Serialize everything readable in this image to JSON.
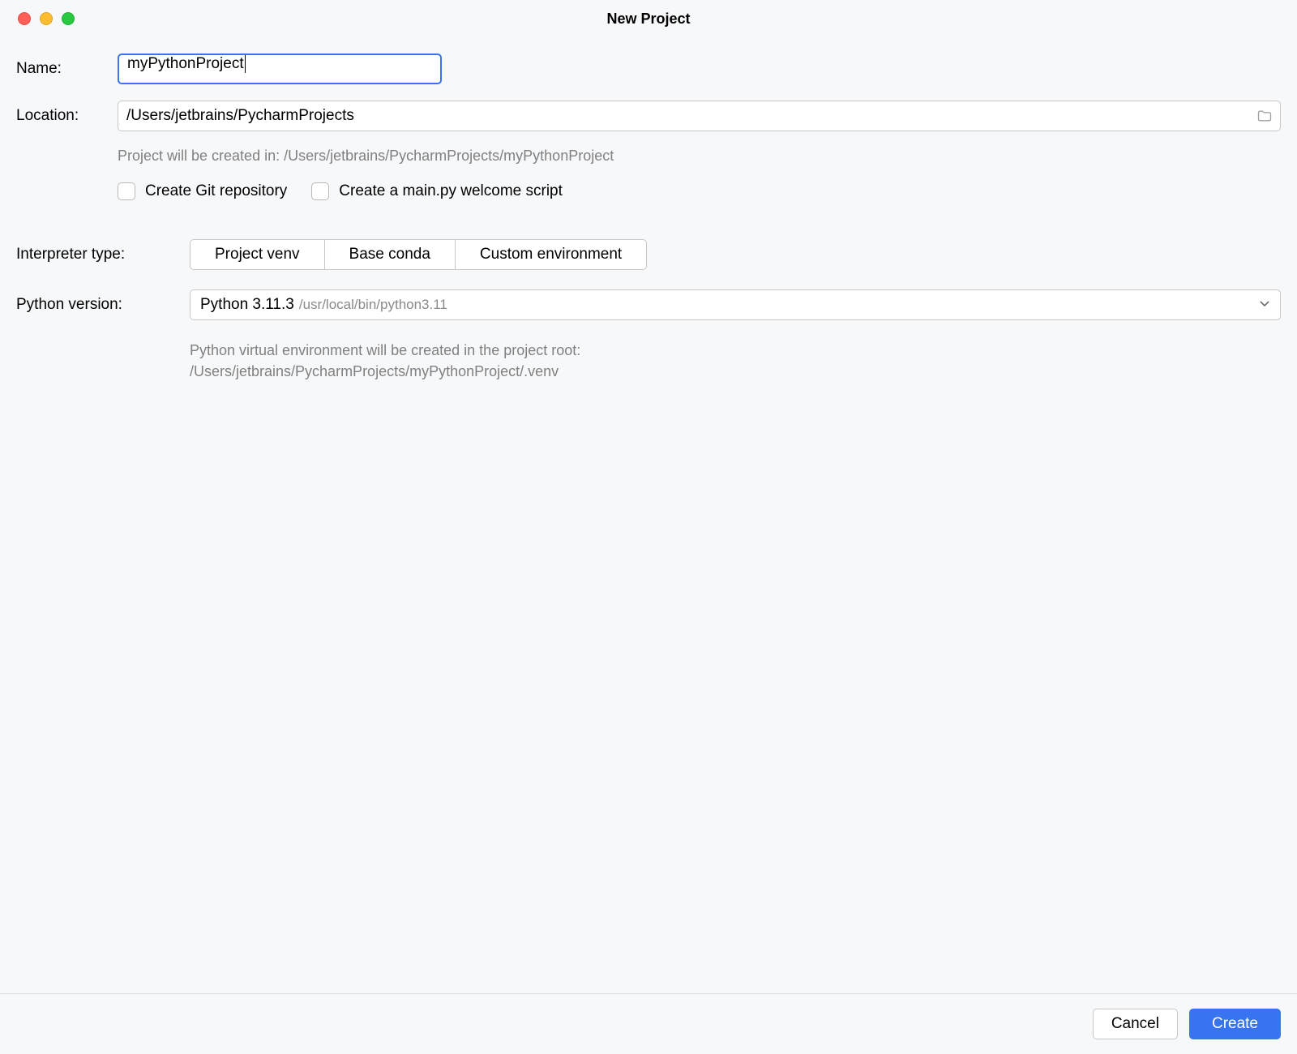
{
  "window": {
    "title": "New Project"
  },
  "labels": {
    "name": "Name:",
    "location": "Location:",
    "interpreter_type": "Interpreter type:",
    "python_version": "Python version:"
  },
  "fields": {
    "name_value": "myPythonProject",
    "location_value": "/Users/jetbrains/PycharmProjects"
  },
  "hints": {
    "project_path": "Project will be created in: /Users/jetbrains/PycharmProjects/myPythonProject",
    "venv_line1": "Python virtual environment will be created in the project root:",
    "venv_line2": "/Users/jetbrains/PycharmProjects/myPythonProject/.venv"
  },
  "checkboxes": {
    "git": "Create Git repository",
    "mainpy": "Create a main.py welcome script"
  },
  "interpreter_segments": {
    "venv": "Project venv",
    "conda": "Base conda",
    "custom": "Custom environment"
  },
  "python_dropdown": {
    "version": "Python 3.11.3",
    "path": "/usr/local/bin/python3.11"
  },
  "buttons": {
    "cancel": "Cancel",
    "create": "Create"
  }
}
